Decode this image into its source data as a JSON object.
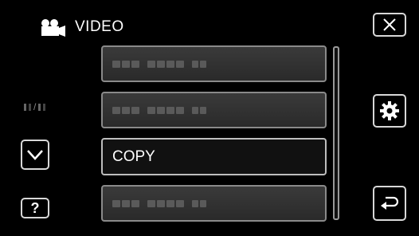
{
  "header": {
    "title": "VIDEO",
    "icon": "video-camera-icon"
  },
  "menu": {
    "items": [
      {
        "label": "",
        "obscured": true
      },
      {
        "label": "",
        "obscured": true
      },
      {
        "label": "COPY",
        "obscured": false,
        "selected": true
      },
      {
        "label": "",
        "obscured": true
      }
    ]
  },
  "page_indicator": {
    "separator": "/"
  },
  "buttons": {
    "close_icon": "close-icon",
    "settings_icon": "gear-icon",
    "back_icon": "return-icon",
    "down_icon": "chevron-down-icon",
    "help_label": "?"
  },
  "colors": {
    "background": "#000000",
    "item_border": "#8a8a8a",
    "text": "#ffffff"
  }
}
